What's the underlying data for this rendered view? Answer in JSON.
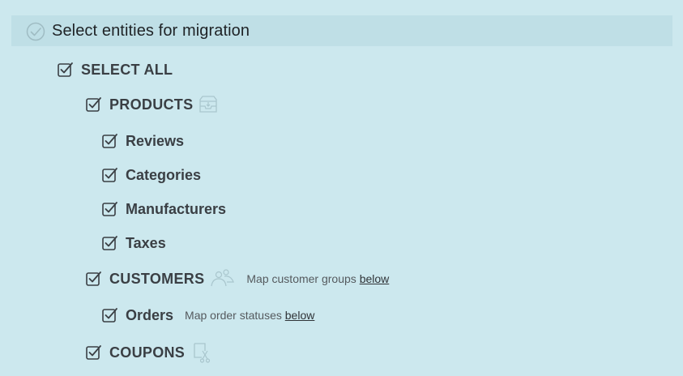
{
  "header": {
    "title": "Select entities for migration",
    "icon": "check-circle-icon"
  },
  "select_all": {
    "label": "SELECT ALL",
    "checked": true
  },
  "products": {
    "label": "PRODUCTS",
    "checked": true,
    "icon": "box-icon"
  },
  "product_children": [
    {
      "label": "Reviews",
      "checked": true
    },
    {
      "label": "Categories",
      "checked": true
    },
    {
      "label": "Manufacturers",
      "checked": true
    },
    {
      "label": "Taxes",
      "checked": true
    }
  ],
  "customers": {
    "label": "CUSTOMERS",
    "checked": true,
    "icon": "users-icon",
    "hint": "Map customer groups",
    "hint_link": "below"
  },
  "orders": {
    "label": "Orders",
    "checked": true,
    "hint": "Map order statuses",
    "hint_link": "below"
  },
  "coupons": {
    "label": "COUPONS",
    "checked": true,
    "icon": "coupon-scissors-icon"
  },
  "colors": {
    "background": "#cce8ee",
    "header_bg": "#bfdfe6",
    "text": "#3a3f44",
    "icon": "#a9c6cd"
  }
}
